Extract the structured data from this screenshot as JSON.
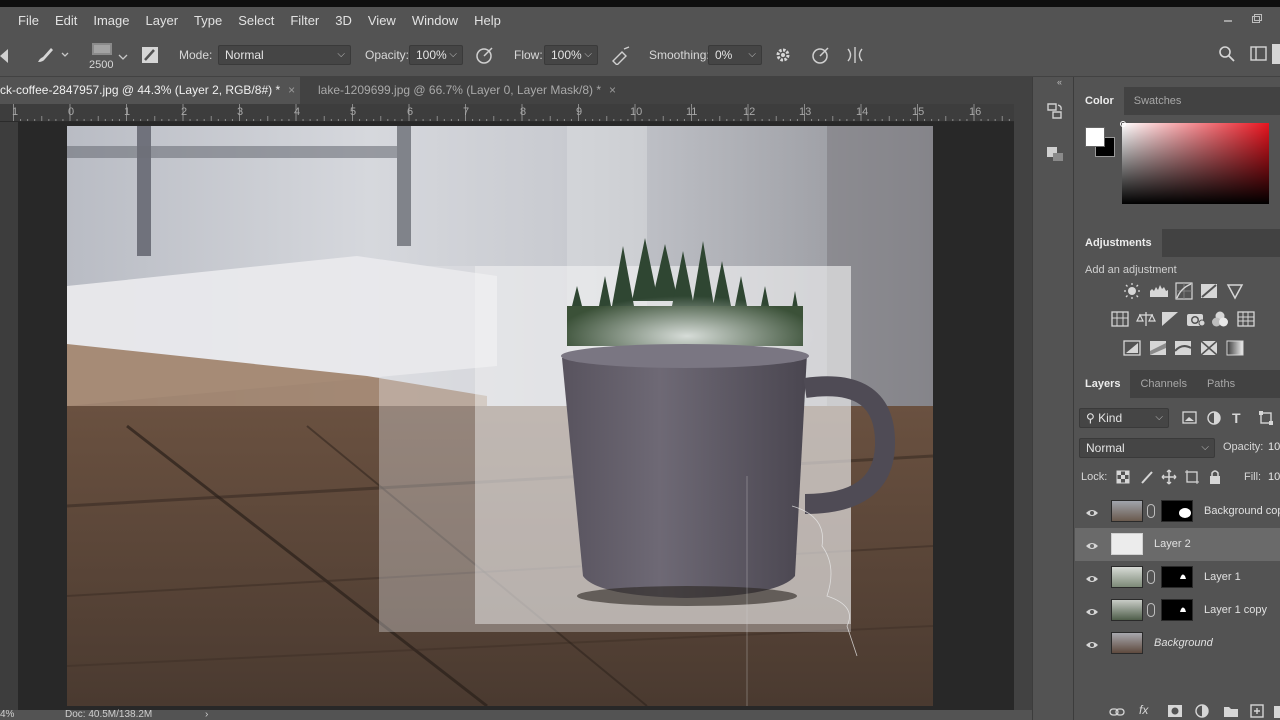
{
  "menu": {
    "items": [
      "File",
      "Edit",
      "Image",
      "Layer",
      "Type",
      "Select",
      "Filter",
      "3D",
      "View",
      "Window",
      "Help"
    ]
  },
  "options_bar": {
    "brush_size": "2500",
    "mode_label": "Mode:",
    "mode_value": "Normal",
    "opacity_label": "Opacity:",
    "opacity_value": "100%",
    "flow_label": "Flow:",
    "flow_value": "100%",
    "smoothing_label": "Smoothing:",
    "smoothing_value": "0%"
  },
  "tabs": [
    {
      "label": "ck-coffee-2847957.jpg @ 44.3% (Layer 2, RGB/8#) *",
      "active": true
    },
    {
      "label": "lake-1209699.jpg @ 66.7% (Layer 0, Layer Mask/8) *",
      "active": false
    }
  ],
  "ruler": {
    "labels": [
      "1",
      "0",
      "1",
      "2",
      "3",
      "4",
      "5",
      "6",
      "7",
      "8",
      "9",
      "10",
      "11",
      "12",
      "13",
      "14",
      "15",
      "16"
    ]
  },
  "status": {
    "zoom": "4%",
    "doc": "Doc: 40.5M/138.2M"
  },
  "color_panel": {
    "tabs": [
      "Color",
      "Swatches"
    ],
    "foreground": "#ffffff",
    "background": "#000000",
    "hue_color": "#e8141f"
  },
  "adjustments_panel": {
    "title": "Adjustments",
    "subtitle": "Add an adjustment",
    "icons_row1": [
      "brightness-contrast",
      "levels",
      "curves",
      "exposure",
      "vibrance"
    ],
    "icons_row2": [
      "hue-saturation",
      "color-balance",
      "black-white",
      "photo-filter",
      "channel-mixer",
      "color-lookup"
    ],
    "icons_row3": [
      "invert",
      "posterize",
      "threshold",
      "selective-color",
      "gradient-map"
    ]
  },
  "layers_panel": {
    "tabs": [
      "Layers",
      "Channels",
      "Paths"
    ],
    "filter_kind": "Kind",
    "blend_mode": "Normal",
    "opacity_label": "Opacity:",
    "opacity_value": "10",
    "lock_label": "Lock:",
    "fill_label": "Fill:",
    "fill_value": "10",
    "layers": [
      {
        "name": "Background cop",
        "has_mask": true,
        "selected": false,
        "italic": false
      },
      {
        "name": "Layer 2",
        "has_mask": false,
        "selected": true,
        "italic": false
      },
      {
        "name": "Layer 1",
        "has_mask": true,
        "selected": false,
        "italic": false
      },
      {
        "name": "Layer 1 copy",
        "has_mask": true,
        "selected": false,
        "italic": false
      },
      {
        "name": "Background",
        "has_mask": false,
        "selected": false,
        "italic": true
      }
    ]
  }
}
